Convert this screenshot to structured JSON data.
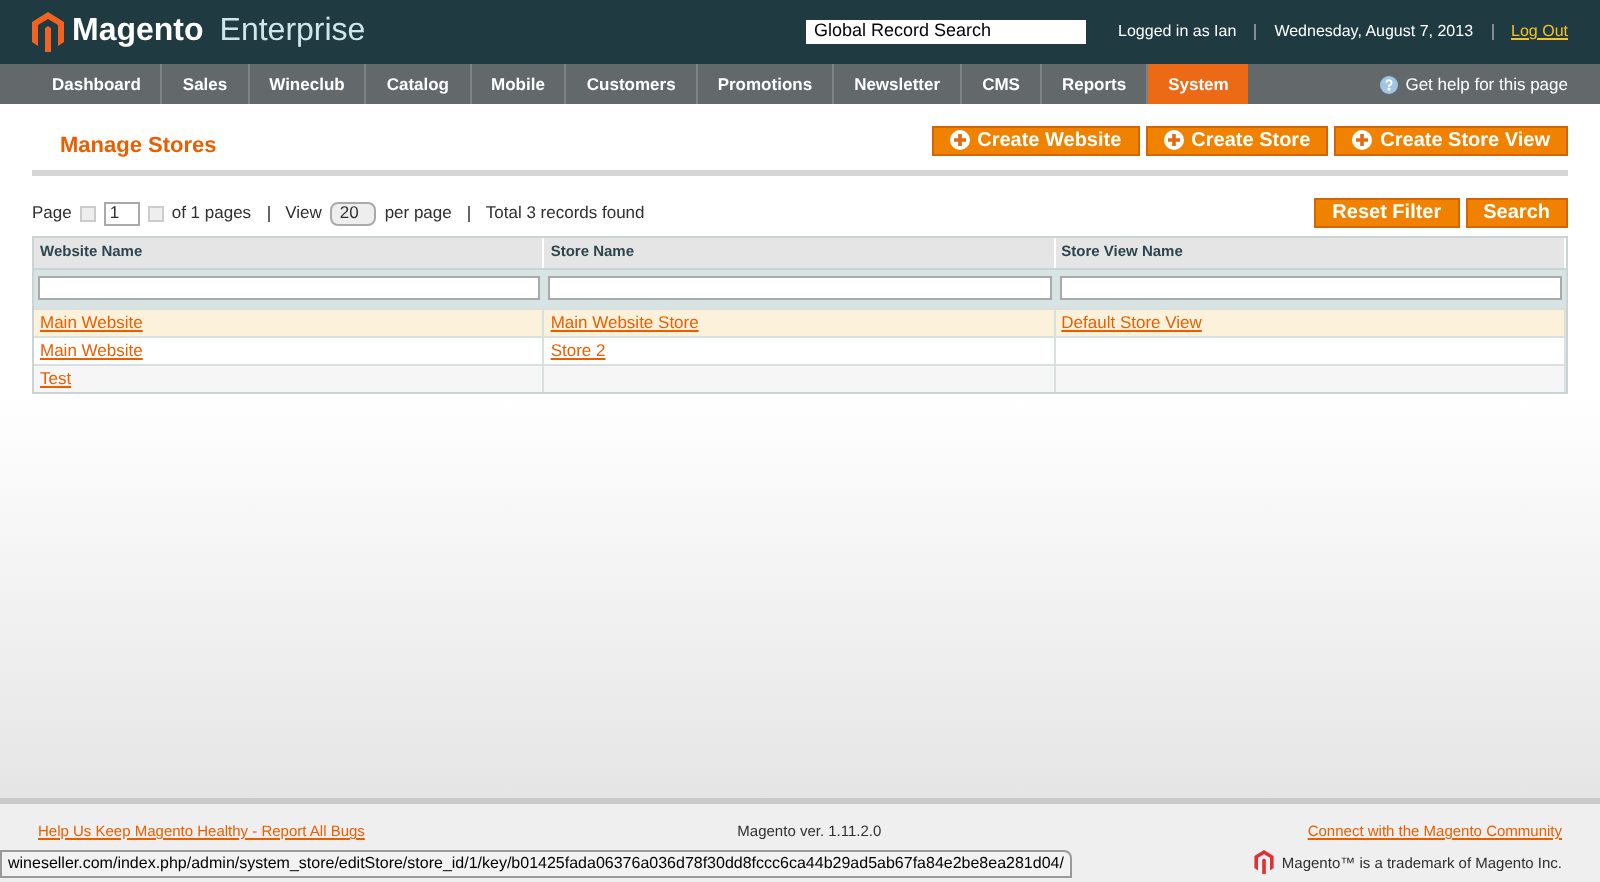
{
  "header": {
    "logo_main": "Magento",
    "logo_sub": "Enterprise",
    "search": {
      "value": "Global Record Search"
    },
    "user": "Logged in as Ian",
    "date": "Wednesday, August 7, 2013",
    "logout": "Log Out"
  },
  "nav": [
    {
      "label": "Dashboard",
      "selected": false
    },
    {
      "label": "Sales",
      "selected": false
    },
    {
      "label": "Wineclub",
      "selected": false
    },
    {
      "label": "Catalog",
      "selected": false
    },
    {
      "label": "Mobile",
      "selected": false
    },
    {
      "label": "Customers",
      "selected": false
    },
    {
      "label": "Promotions",
      "selected": false
    },
    {
      "label": "Newsletter",
      "selected": false
    },
    {
      "label": "CMS",
      "selected": false
    },
    {
      "label": "Reports",
      "selected": false
    },
    {
      "label": "System",
      "selected": true
    }
  ],
  "help": "Get help for this page",
  "page_title": "Manage Stores",
  "actions": [
    "Create Website",
    "Create Store",
    "Create Store View"
  ],
  "pager": {
    "page_label": "Page",
    "page": "1",
    "of_pages": "of 1 pages",
    "view_label": "View",
    "per_page": "20",
    "per_page_label": "per page",
    "total": "Total 3 records found"
  },
  "filter_buttons": [
    "Reset Filter",
    "Search"
  ],
  "table": {
    "columns": [
      "Website Name",
      "Store Name",
      "Store View Name"
    ],
    "rows": [
      {
        "selected": true,
        "cells": [
          "Main Website",
          "Main Website Store",
          "Default Store View"
        ]
      },
      {
        "selected": false,
        "cells": [
          "Main Website",
          "Store 2",
          ""
        ]
      },
      {
        "selected": false,
        "cells": [
          "Test",
          "",
          ""
        ]
      }
    ]
  },
  "footer": {
    "bugs_link": "Help Us Keep Magento Healthy - Report All Bugs",
    "version": "Magento ver. 1.11.2.0",
    "community_link": "Connect with the Magento Community",
    "trademark": "Magento™ is a trademark of Magento Inc."
  },
  "status_url": "wineseller.com/index.php/admin/system_store/editStore/store_id/1/key/b01425fada06376a036d78f30dd8fccc6ca44b29ad5ab67fa84e2be8ea281d04/"
}
